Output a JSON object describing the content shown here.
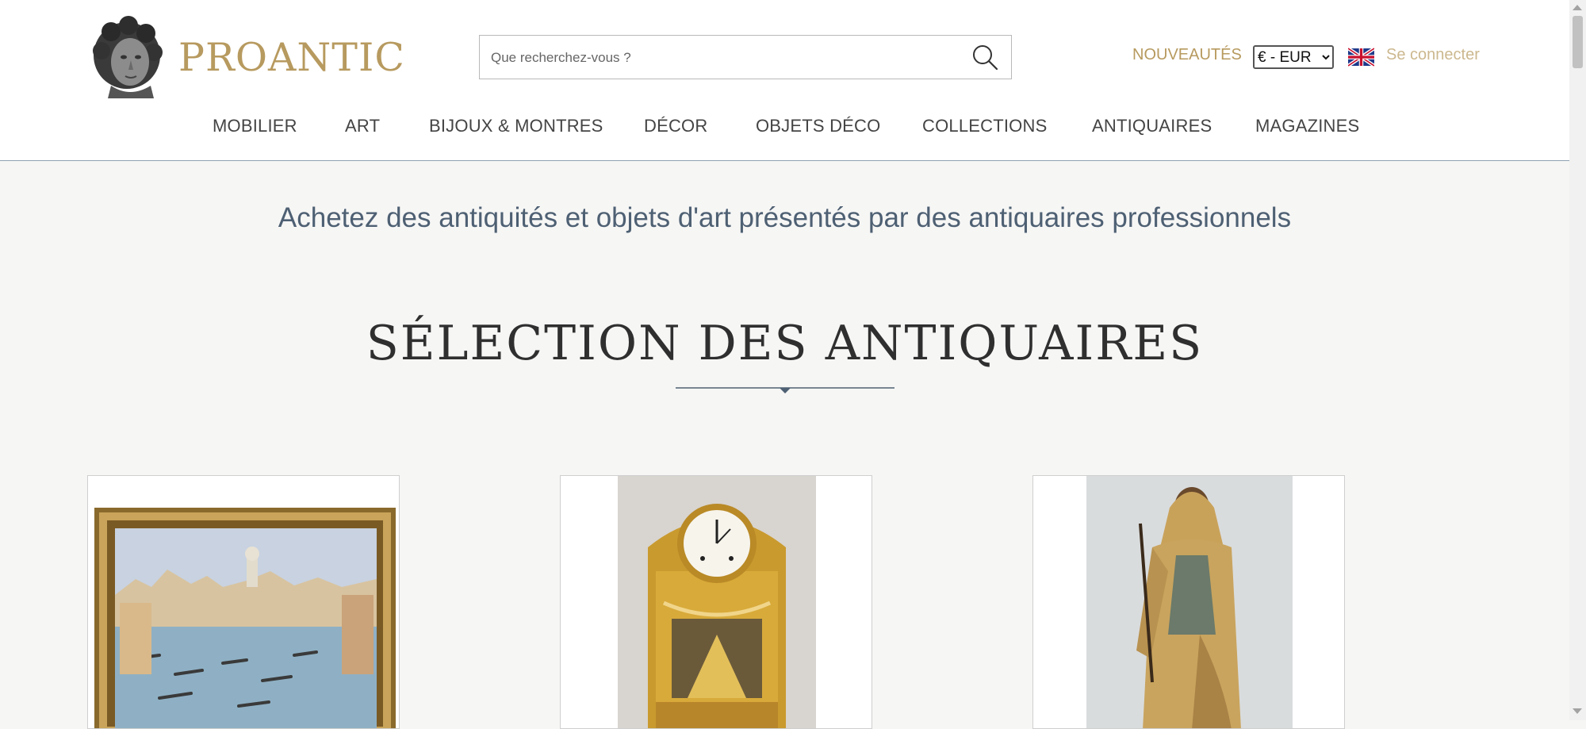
{
  "brand": {
    "name": "PROANTIC"
  },
  "search": {
    "placeholder": "Que recherchez-vous ?"
  },
  "header_links": {
    "new": "NOUVEAUTÉS",
    "currency_selected": "€ - EUR",
    "login": "Se connecter"
  },
  "nav": {
    "items": [
      {
        "label": "MOBILIER"
      },
      {
        "label": "ART"
      },
      {
        "label": "BIJOUX & MONTRES"
      },
      {
        "label": "DÉCOR"
      },
      {
        "label": "OBJETS DÉCO"
      },
      {
        "label": "COLLECTIONS"
      },
      {
        "label": "ANTIQUAIRES"
      },
      {
        "label": "MAGAZINES"
      }
    ]
  },
  "main": {
    "tagline": "Achetez des antiquités et objets d'art présentés par des antiquaires professionnels",
    "section_title": "SÉLECTION DES ANTIQUAIRES"
  },
  "colors": {
    "brand_gold": "#b79a5f",
    "nav_text": "#444444",
    "tagline_blue": "#4e6073",
    "page_background": "#f6f6f5"
  },
  "icons": [
    "search-icon",
    "uk-flag-icon"
  ]
}
